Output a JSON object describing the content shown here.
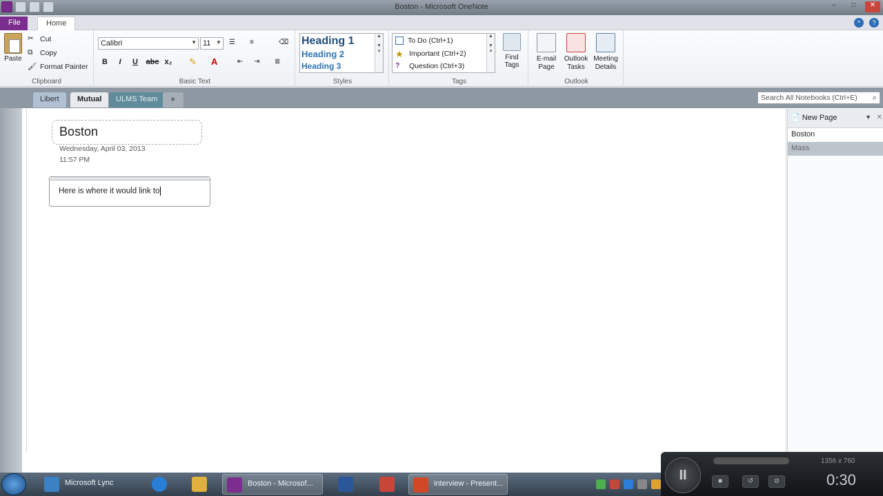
{
  "window": {
    "title": "Boston - Microsoft OneNote"
  },
  "ribbon": {
    "tabs": {
      "file": "File",
      "home": "Home"
    },
    "clipboard": {
      "label": "Clipboard",
      "paste": "Paste",
      "cut": "Cut",
      "copy": "Copy",
      "format_painter": "Format Painter"
    },
    "basic_text": {
      "label": "Basic Text",
      "font": "Calibri",
      "size": "11",
      "bold": "B",
      "italic": "I",
      "underline": "U",
      "strike": "abc",
      "subscript": "x₂"
    },
    "styles": {
      "label": "Styles",
      "items": [
        "Heading 1",
        "Heading 2",
        "Heading 3"
      ]
    },
    "tags": {
      "label": "Tags",
      "items": [
        "To Do (Ctrl+1)",
        "Important (Ctrl+2)",
        "Question (Ctrl+3)"
      ],
      "find_tags_line1": "Find",
      "find_tags_line2": "Tags"
    },
    "outlook": {
      "label": "Outlook",
      "email_line1": "E-mail",
      "email_line2": "Page",
      "tasks_line1": "Outlook",
      "tasks_line2": "Tasks",
      "meeting_line1": "Meeting",
      "meeting_line2": "Details"
    }
  },
  "sections": {
    "tabs": [
      "Libert",
      "Mutual",
      "ULMS Team"
    ],
    "search_placeholder": "Search All Notebooks (Ctrl+E)"
  },
  "page": {
    "title": "Boston",
    "date": "Wednesday, April 03, 2013",
    "time": "11:57 PM",
    "note": "Here is where it would link to"
  },
  "pagelist": {
    "new_page": "New Page",
    "items": [
      "Boston",
      "Mass"
    ]
  },
  "taskbar": {
    "items": [
      "Microsoft Lync",
      "",
      "",
      "Boston - Microsof...",
      "",
      "",
      "interview - Present..."
    ]
  },
  "recorder": {
    "resolution": "1356 x 760",
    "elapsed": "0:30"
  },
  "colors": {
    "file_tab": "#7b2e8e",
    "heading_blue": "#1f4e79"
  }
}
